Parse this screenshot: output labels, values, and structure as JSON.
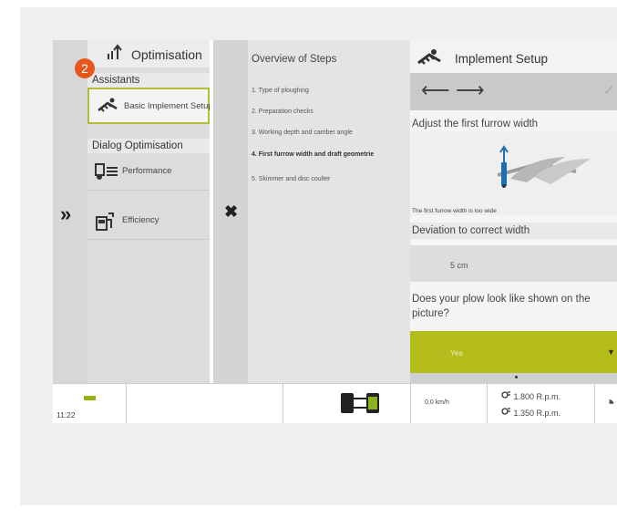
{
  "colors": {
    "accent": "#b4bd1c",
    "badge": "#e8561b",
    "selected_border": "#b1be36",
    "battery": "#93b313"
  },
  "badge": {
    "number": "2"
  },
  "left_strip": {
    "expand_icon": "»"
  },
  "optimisation": {
    "title": "Optimisation",
    "title_icon": "optimisation-arrow-icon",
    "assistants_label": "Assistants",
    "dialog_label": "Dialog Optimisation",
    "items": [
      {
        "label": "Basic Implement Setup",
        "icon": "implement-icon",
        "selected": true
      },
      {
        "label": "Performance",
        "icon": "performance-icon",
        "selected": false
      },
      {
        "label": "Efficiency",
        "icon": "fuel-efficiency-icon",
        "selected": false
      }
    ]
  },
  "close": {
    "icon": "✖"
  },
  "steps": {
    "title": "Overview of Steps",
    "items": [
      {
        "label": "1. Type of ploughing",
        "active": false
      },
      {
        "label": "2. Preparation checks",
        "active": false
      },
      {
        "label": "3. Working depth and camber angle",
        "active": false
      },
      {
        "label": "4. First furrow width and draft geometrie",
        "active": true
      },
      {
        "label": "5. Skimmer and disc coulter",
        "active": false
      }
    ]
  },
  "setup": {
    "title": "Implement Setup",
    "back_icon": "⟵",
    "forward_icon": "⟶",
    "confirm_icon": "✓",
    "instruction": "Adjust the first furrow width",
    "image_caption": "The first furrow width is too wide",
    "deviation_label": "Deviation to correct width",
    "deviation_value": "5 cm",
    "question": "Does your plow look like shown on the picture?",
    "answer": "Yes",
    "answer_dropdown_icon": "▼"
  },
  "status": {
    "time": "11:22",
    "speed": "0,0 km/h",
    "rpm_1": "1.800 R.p.m.",
    "rpm_2": "1.350 R.p.m.",
    "gauge_icon": "◔"
  }
}
